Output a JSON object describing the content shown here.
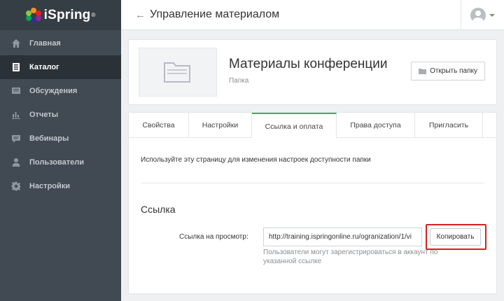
{
  "app": {
    "brand": "iSpring",
    "reg_mark": "®"
  },
  "sidebar": {
    "items": [
      {
        "label": "Главная",
        "icon": "home-icon",
        "active": false
      },
      {
        "label": "Каталог",
        "icon": "catalog-icon",
        "active": true
      },
      {
        "label": "Обсуждения",
        "icon": "discussions-icon",
        "active": false
      },
      {
        "label": "Отчеты",
        "icon": "reports-icon",
        "active": false
      },
      {
        "label": "Вебинары",
        "icon": "webinars-icon",
        "active": false
      },
      {
        "label": "Пользователи",
        "icon": "users-icon",
        "active": false
      },
      {
        "label": "Настройки",
        "icon": "settings-icon",
        "active": false
      }
    ]
  },
  "header": {
    "back_arrow": "←",
    "title": "Управление материалом"
  },
  "folder": {
    "name": "Материалы конференции",
    "type": "Папка",
    "open_button": "Открыть папку"
  },
  "tabs": [
    {
      "label": "Свойства",
      "active": false
    },
    {
      "label": "Настройки",
      "active": false
    },
    {
      "label": "Ссылка и оплата",
      "active": true
    },
    {
      "label": "Права доступа",
      "active": false
    },
    {
      "label": "Пригласить",
      "active": false
    }
  ],
  "panel": {
    "description": "Используйте эту страницу для изменения настроек доступности папки",
    "section_title": "Ссылка",
    "field_label": "Ссылка на просмотр:",
    "url_value": "http://training.ispringonline.ru/ogranization/1/vi",
    "copy_button": "Копировать",
    "hint": "Пользователи могут зарегистрироваться в аккаунт по указанной ссылке"
  },
  "colors": {
    "sidebar_bg": "#414a52",
    "sidebar_active": "#2b3237",
    "tab_accent": "#3ab54a",
    "highlight": "#d62020"
  }
}
